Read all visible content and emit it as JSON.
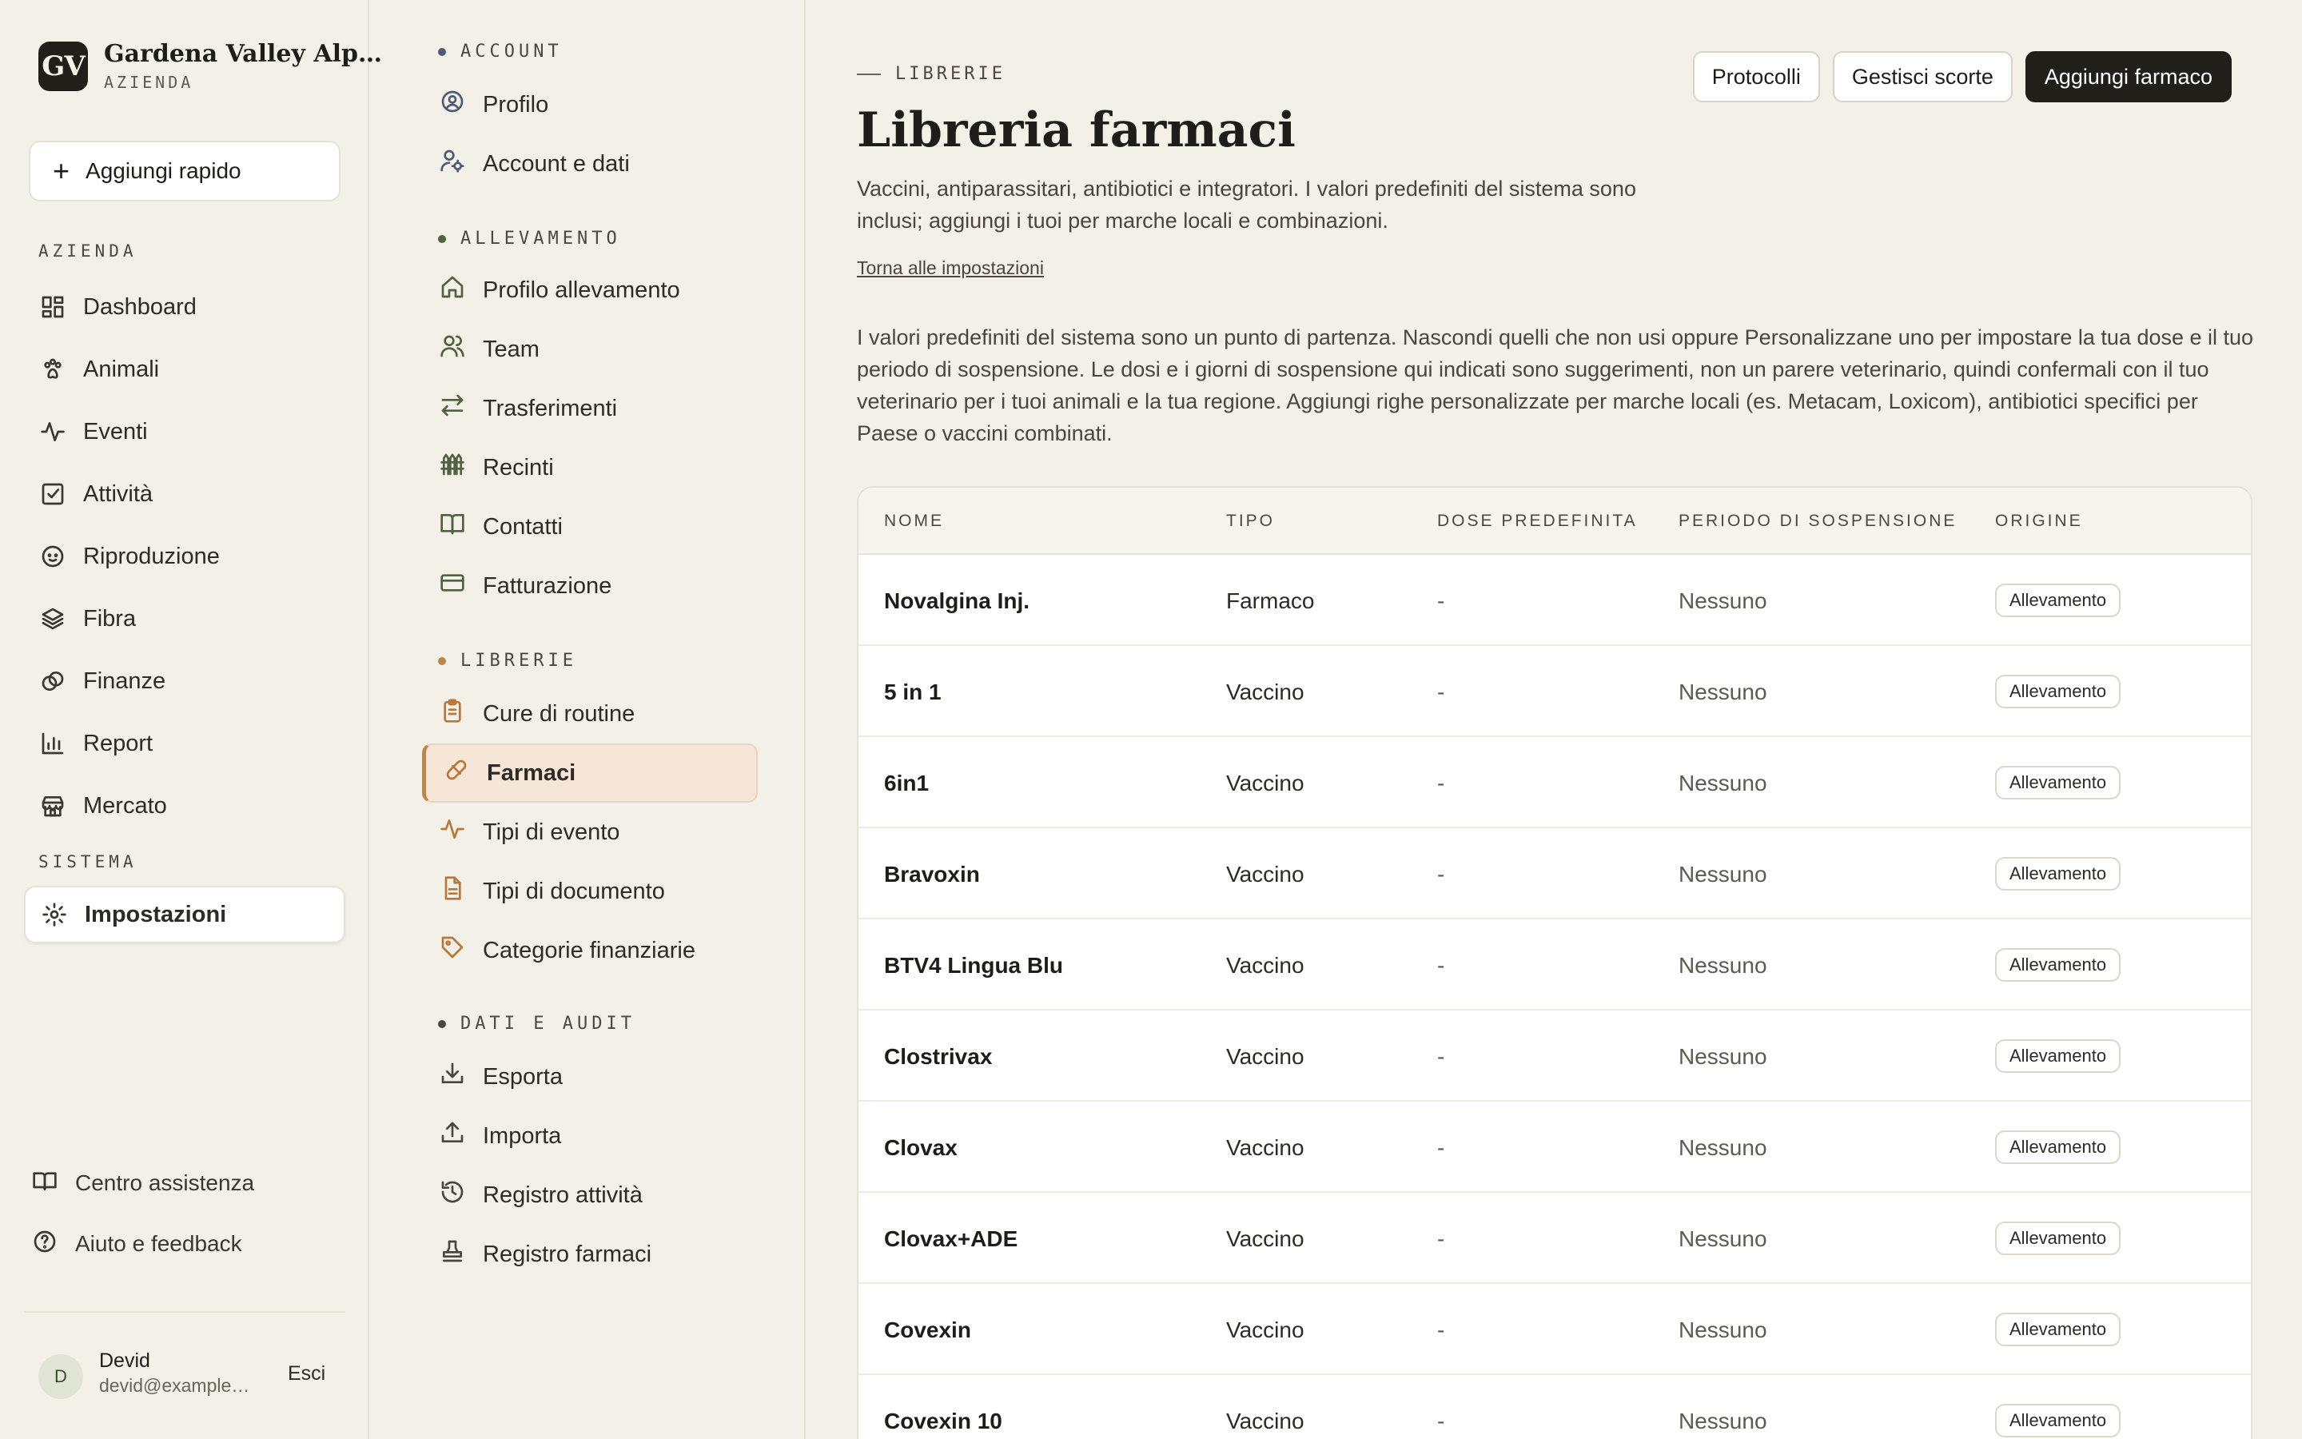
{
  "brand": {
    "logo": "GV",
    "name": "Gardena Valley Alp…",
    "subtitle": "AZIENDA"
  },
  "quick_add": {
    "label": "Aggiungi rapido"
  },
  "sidebar": {
    "section_azienda": "AZIENDA",
    "items": [
      {
        "label": "Dashboard",
        "icon": "dashboard-icon"
      },
      {
        "label": "Animali",
        "icon": "paw-icon"
      },
      {
        "label": "Eventi",
        "icon": "activity-icon"
      },
      {
        "label": "Attività",
        "icon": "checkbox-icon"
      },
      {
        "label": "Riproduzione",
        "icon": "baby-icon"
      },
      {
        "label": "Fibra",
        "icon": "layers-icon"
      },
      {
        "label": "Finanze",
        "icon": "coins-icon"
      },
      {
        "label": "Report",
        "icon": "bar-chart-icon"
      },
      {
        "label": "Mercato",
        "icon": "store-icon"
      }
    ],
    "section_sistema": "SISTEMA",
    "settings": {
      "label": "Impostazioni",
      "icon": "gear-icon"
    },
    "footer": [
      {
        "label": "Centro assistenza",
        "icon": "book-icon"
      },
      {
        "label": "Aiuto e feedback",
        "icon": "help-icon"
      }
    ],
    "user": {
      "initial": "D",
      "name": "Devid",
      "email": "devid@example…",
      "logout": "Esci"
    }
  },
  "submenu": {
    "account": {
      "label": "ACCOUNT",
      "items": [
        {
          "label": "Profilo",
          "icon": "user-circle-icon"
        },
        {
          "label": "Account e dati",
          "icon": "user-cog-icon"
        }
      ]
    },
    "allevamento": {
      "label": "ALLEVAMENTO",
      "items": [
        {
          "label": "Profilo allevamento",
          "icon": "home-icon"
        },
        {
          "label": "Team",
          "icon": "users-icon"
        },
        {
          "label": "Trasferimenti",
          "icon": "arrows-icon"
        },
        {
          "label": "Recinti",
          "icon": "fence-icon"
        },
        {
          "label": "Contatti",
          "icon": "book-open-icon"
        },
        {
          "label": "Fatturazione",
          "icon": "credit-card-icon"
        }
      ]
    },
    "librerie": {
      "label": "LIBRERIE",
      "items": [
        {
          "label": "Cure di routine",
          "icon": "clipboard-icon"
        },
        {
          "label": "Farmaci",
          "icon": "pill-icon"
        },
        {
          "label": "Tipi di evento",
          "icon": "activity-icon"
        },
        {
          "label": "Tipi di documento",
          "icon": "file-icon"
        },
        {
          "label": "Categorie finanziarie",
          "icon": "tag-icon"
        }
      ]
    },
    "dati": {
      "label": "DATI E AUDIT",
      "items": [
        {
          "label": "Esporta",
          "icon": "download-icon"
        },
        {
          "label": "Importa",
          "icon": "upload-icon"
        },
        {
          "label": "Registro attività",
          "icon": "history-icon"
        },
        {
          "label": "Registro farmaci",
          "icon": "stamp-icon"
        }
      ]
    }
  },
  "main": {
    "eyebrow": "LIBRERIE",
    "title": "Libreria farmaci",
    "description": "Vaccini, antiparassitari, antibiotici e integratori. I valori predefiniti del sistema sono inclusi; aggiungi i tuoi per marche locali e combinazioni.",
    "back_link": "Torna alle impostazioni",
    "info": "I valori predefiniti del sistema sono un punto di partenza. Nascondi quelli che non usi oppure Personalizzane uno per impostare la tua dose e il tuo periodo di sospensione. Le dosi e i giorni di sospensione qui indicati sono suggerimenti, non un parere veterinario, quindi confermali con il tuo veterinario per i tuoi animali e la tua regione. Aggiungi righe personalizzate per marche locali (es. Metacam, Loxicom), antibiotici specifici per Paese o vaccini combinati.",
    "buttons": {
      "protocols": "Protocolli",
      "stock": "Gestisci scorte",
      "add": "Aggiungi farmaco"
    }
  },
  "table": {
    "headers": [
      "NOME",
      "TIPO",
      "DOSE PREDEFINITA",
      "PERIODO DI SOSPENSIONE",
      "ORIGINE"
    ],
    "rows": [
      {
        "name": "Novalgina Inj.",
        "type": "Farmaco",
        "dose": "-",
        "withdrawal": "Nessuno",
        "origin": "Allevamento"
      },
      {
        "name": "5 in 1",
        "type": "Vaccino",
        "dose": "-",
        "withdrawal": "Nessuno",
        "origin": "Allevamento"
      },
      {
        "name": "6in1",
        "type": "Vaccino",
        "dose": "-",
        "withdrawal": "Nessuno",
        "origin": "Allevamento"
      },
      {
        "name": "Bravoxin",
        "type": "Vaccino",
        "dose": "-",
        "withdrawal": "Nessuno",
        "origin": "Allevamento"
      },
      {
        "name": "BTV4 Lingua Blu",
        "type": "Vaccino",
        "dose": "-",
        "withdrawal": "Nessuno",
        "origin": "Allevamento"
      },
      {
        "name": "Clostrivax",
        "type": "Vaccino",
        "dose": "-",
        "withdrawal": "Nessuno",
        "origin": "Allevamento"
      },
      {
        "name": "Clovax",
        "type": "Vaccino",
        "dose": "-",
        "withdrawal": "Nessuno",
        "origin": "Allevamento"
      },
      {
        "name": "Clovax+ADE",
        "type": "Vaccino",
        "dose": "-",
        "withdrawal": "Nessuno",
        "origin": "Allevamento"
      },
      {
        "name": "Covexin",
        "type": "Vaccino",
        "dose": "-",
        "withdrawal": "Nessuno",
        "origin": "Allevamento"
      },
      {
        "name": "Covexin 10",
        "type": "Vaccino",
        "dose": "-",
        "withdrawal": "Nessuno",
        "origin": "Allevamento"
      }
    ]
  },
  "colors": {
    "background": "#f3f0e8",
    "primary_button": "#221f1b",
    "active_submenu": "#f5e6d8",
    "accent_orange": "#c0834a",
    "dot_account": "#4c5a7a",
    "dot_allevamento": "#4e6140",
    "dot_librerie": "#c0834a",
    "dot_dati": "#4a463f"
  }
}
